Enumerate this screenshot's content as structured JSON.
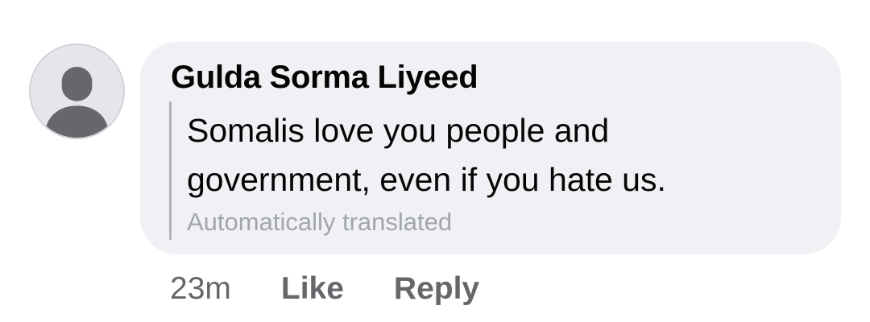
{
  "comment": {
    "avatar_icon": "default-profile-silhouette",
    "author": "Gulda Sorma Liyeed",
    "text": "Somalis love you people and\ngovernment, even if you hate us.",
    "translation_note": "Automatically translated",
    "time": "23m",
    "actions": {
      "like": "Like",
      "reply": "Reply"
    }
  },
  "colors": {
    "bubble_background": "#f0f1f4",
    "secondary_text": "#65676b",
    "muted_text": "#a2a5aa",
    "primary_text": "#050505"
  }
}
